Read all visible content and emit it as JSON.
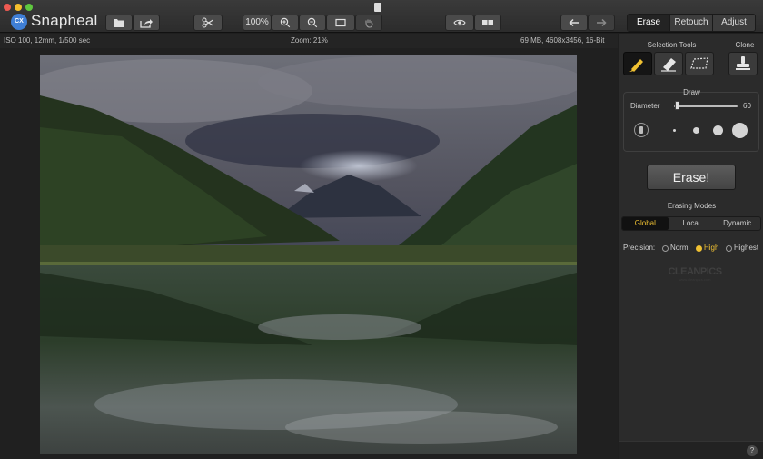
{
  "app": {
    "title": "Snapheal",
    "logo_text": "CX"
  },
  "toolbar": {
    "zoom_label": "100%",
    "mode_tabs": [
      "Erase",
      "Retouch",
      "Adjust"
    ],
    "active_mode": "Erase"
  },
  "infobar": {
    "exif": "ISO 100, 12mm, 1/500 sec",
    "zoom": "Zoom: 21%",
    "file_info": "69 MB, 4608x3456, 16-Bit"
  },
  "panel": {
    "selection_tools_label": "Selection Tools",
    "clone_label": "Clone",
    "draw_label": "Draw",
    "diameter_label": "Diameter",
    "diameter_value": "60",
    "erase_button": "Erase!",
    "erasing_modes_label": "Erasing Modes",
    "modes": [
      "Global",
      "Local",
      "Dynamic"
    ],
    "active_mode": "Global",
    "precision_label": "Precision:",
    "precision_options": [
      "Norm",
      "High",
      "Highest"
    ],
    "active_precision": "High",
    "watermark": "CLEANPICS",
    "watermark_small": "www.cleanpics.com",
    "help": "?"
  },
  "colors": {
    "accent": "#f0c132",
    "panel": "#2b2b2b",
    "toolbar": "#333333"
  }
}
